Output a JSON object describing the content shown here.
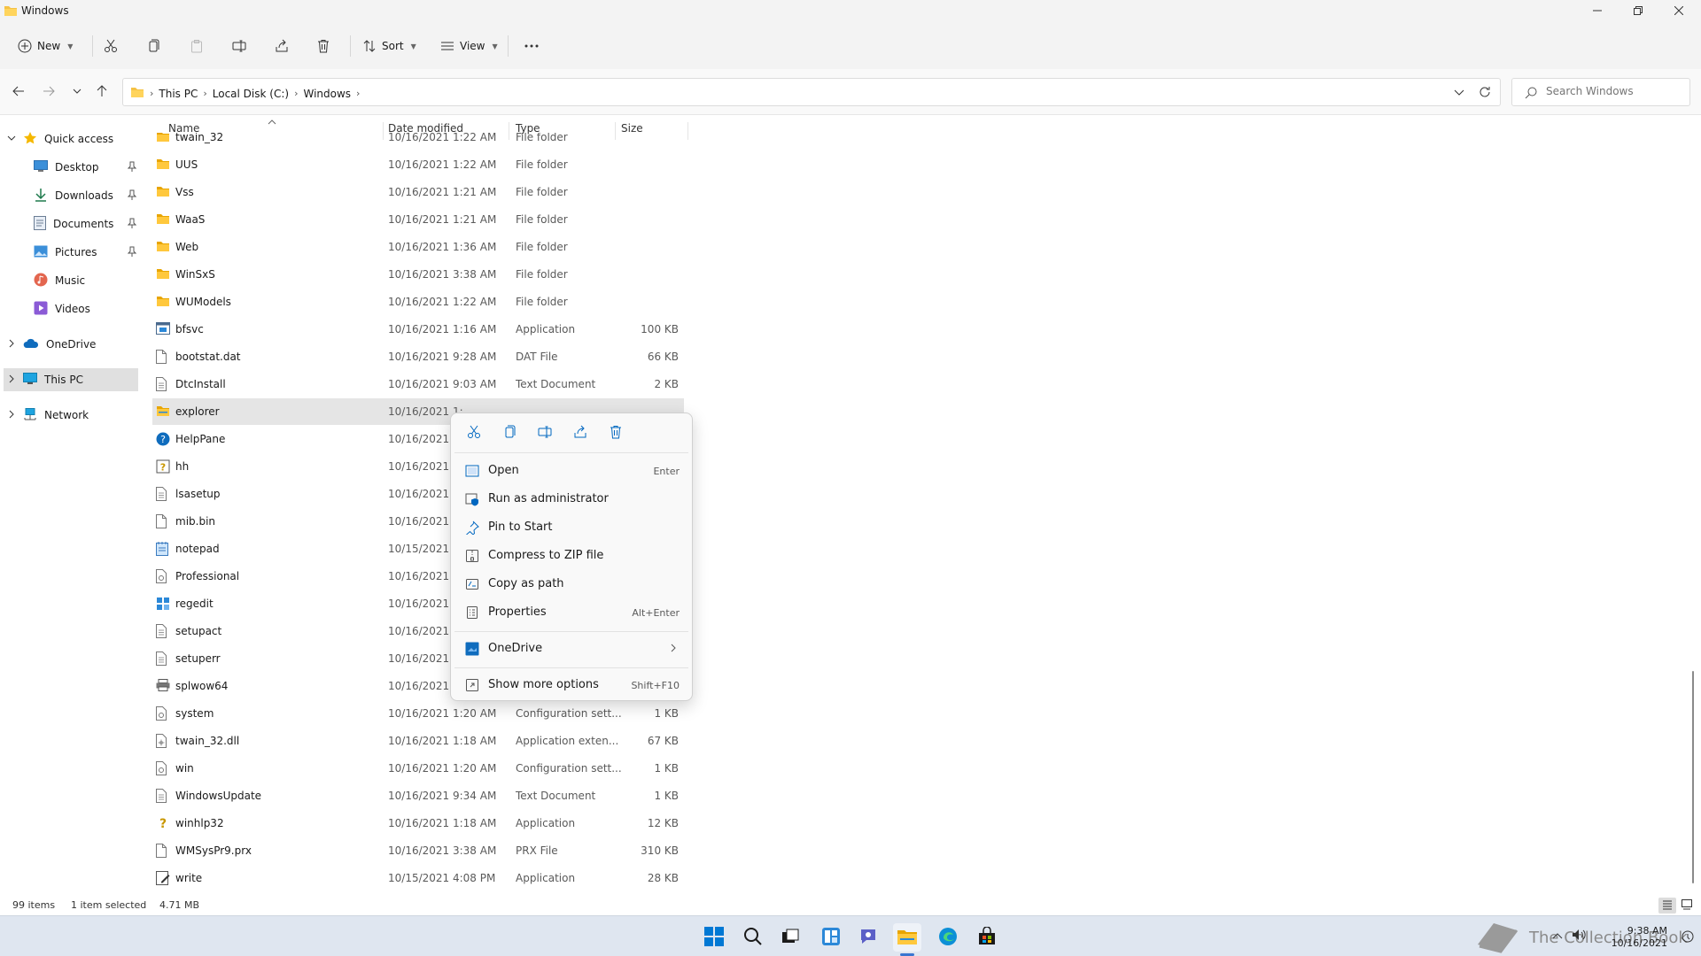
{
  "window": {
    "title": "Windows"
  },
  "toolbar": {
    "new_label": "New",
    "sort_label": "Sort",
    "view_label": "View"
  },
  "address": {
    "crumbs": [
      "This PC",
      "Local Disk (C:)",
      "Windows"
    ]
  },
  "search": {
    "placeholder": "Search Windows"
  },
  "nav": {
    "items": [
      {
        "label": "Quick access",
        "icon": "star-icon"
      },
      {
        "label": "Desktop",
        "icon": "desktop-icon"
      },
      {
        "label": "Downloads",
        "icon": "download-icon"
      },
      {
        "label": "Documents",
        "icon": "document-icon"
      },
      {
        "label": "Pictures",
        "icon": "picture-icon"
      },
      {
        "label": "Music",
        "icon": "music-icon"
      },
      {
        "label": "Videos",
        "icon": "video-icon"
      },
      {
        "label": "OneDrive",
        "icon": "cloud-icon"
      },
      {
        "label": "This PC",
        "icon": "monitor-icon"
      },
      {
        "label": "Network",
        "icon": "network-icon"
      }
    ]
  },
  "columns": {
    "name": "Name",
    "date": "Date modified",
    "type": "Type",
    "size": "Size"
  },
  "files": [
    {
      "name": "twain_32",
      "date": "10/16/2021 1:22 AM",
      "type": "File folder",
      "size": "",
      "icon": "folder"
    },
    {
      "name": "UUS",
      "date": "10/16/2021 1:22 AM",
      "type": "File folder",
      "size": "",
      "icon": "folder"
    },
    {
      "name": "Vss",
      "date": "10/16/2021 1:21 AM",
      "type": "File folder",
      "size": "",
      "icon": "folder"
    },
    {
      "name": "WaaS",
      "date": "10/16/2021 1:21 AM",
      "type": "File folder",
      "size": "",
      "icon": "folder"
    },
    {
      "name": "Web",
      "date": "10/16/2021 1:36 AM",
      "type": "File folder",
      "size": "",
      "icon": "folder"
    },
    {
      "name": "WinSxS",
      "date": "10/16/2021 3:38 AM",
      "type": "File folder",
      "size": "",
      "icon": "folder"
    },
    {
      "name": "WUModels",
      "date": "10/16/2021 1:22 AM",
      "type": "File folder",
      "size": "",
      "icon": "folder"
    },
    {
      "name": "bfsvc",
      "date": "10/16/2021 1:16 AM",
      "type": "Application",
      "size": "100 KB",
      "icon": "app"
    },
    {
      "name": "bootstat.dat",
      "date": "10/16/2021 9:28 AM",
      "type": "DAT File",
      "size": "66 KB",
      "icon": "file"
    },
    {
      "name": "DtcInstall",
      "date": "10/16/2021 9:03 AM",
      "type": "Text Document",
      "size": "2 KB",
      "icon": "text"
    },
    {
      "name": "explorer",
      "date": "10/16/2021 1:",
      "type": "",
      "size": "",
      "icon": "explorer"
    },
    {
      "name": "HelpPane",
      "date": "10/16/2021 1:",
      "type": "",
      "size": "",
      "icon": "help"
    },
    {
      "name": "hh",
      "date": "10/16/2021 1:",
      "type": "",
      "size": "",
      "icon": "hh"
    },
    {
      "name": "lsasetup",
      "date": "10/16/2021 9:",
      "type": "",
      "size": "",
      "icon": "text"
    },
    {
      "name": "mib.bin",
      "date": "10/16/2021 1:",
      "type": "",
      "size": "",
      "icon": "file"
    },
    {
      "name": "notepad",
      "date": "10/15/2021 3:",
      "type": "",
      "size": "",
      "icon": "notepad"
    },
    {
      "name": "Professional",
      "date": "10/16/2021 1:",
      "type": "",
      "size": "",
      "icon": "config"
    },
    {
      "name": "regedit",
      "date": "10/16/2021 1:",
      "type": "",
      "size": "",
      "icon": "regedit"
    },
    {
      "name": "setupact",
      "date": "10/16/2021 9:",
      "type": "",
      "size": "",
      "icon": "text"
    },
    {
      "name": "setuperr",
      "date": "10/16/2021 9:",
      "type": "",
      "size": "",
      "icon": "text"
    },
    {
      "name": "splwow64",
      "date": "10/16/2021 1:",
      "type": "",
      "size": "",
      "icon": "printer"
    },
    {
      "name": "system",
      "date": "10/16/2021 1:20 AM",
      "type": "Configuration sett...",
      "size": "1 KB",
      "icon": "config"
    },
    {
      "name": "twain_32.dll",
      "date": "10/16/2021 1:18 AM",
      "type": "Application exten...",
      "size": "67 KB",
      "icon": "dll"
    },
    {
      "name": "win",
      "date": "10/16/2021 1:20 AM",
      "type": "Configuration sett...",
      "size": "1 KB",
      "icon": "config"
    },
    {
      "name": "WindowsUpdate",
      "date": "10/16/2021 9:34 AM",
      "type": "Text Document",
      "size": "1 KB",
      "icon": "text"
    },
    {
      "name": "winhlp32",
      "date": "10/16/2021 1:18 AM",
      "type": "Application",
      "size": "12 KB",
      "icon": "winhlp"
    },
    {
      "name": "WMSysPr9.prx",
      "date": "10/16/2021 3:38 AM",
      "type": "PRX File",
      "size": "310 KB",
      "icon": "file"
    },
    {
      "name": "write",
      "date": "10/15/2021 4:08 PM",
      "type": "Application",
      "size": "28 KB",
      "icon": "write"
    }
  ],
  "context_menu": {
    "items": [
      {
        "label": "Open",
        "shortcut": "Enter",
        "icon": "open-icon"
      },
      {
        "label": "Run as administrator",
        "shortcut": "",
        "icon": "shield-icon"
      },
      {
        "label": "Pin to Start",
        "shortcut": "",
        "icon": "pin-icon"
      },
      {
        "label": "Compress to ZIP file",
        "shortcut": "",
        "icon": "zip-icon"
      },
      {
        "label": "Copy as path",
        "shortcut": "",
        "icon": "copy-path-icon"
      },
      {
        "label": "Properties",
        "shortcut": "Alt+Enter",
        "icon": "properties-icon"
      },
      {
        "label": "OneDrive",
        "shortcut": "",
        "icon": "onedrive-icon"
      },
      {
        "label": "Show more options",
        "shortcut": "Shift+F10",
        "icon": "more-options-icon"
      }
    ]
  },
  "status": {
    "item_count": "99 items",
    "selection": "1 item selected",
    "selection_size": "4.71 MB"
  },
  "taskbar": {
    "time": "9:38 AM",
    "date": "10/16/2021",
    "watermark": "The Collection Book"
  },
  "colors": {
    "accent": "#0067c0",
    "folder": "#f5c244",
    "selected_row": "#e5e5e5"
  }
}
